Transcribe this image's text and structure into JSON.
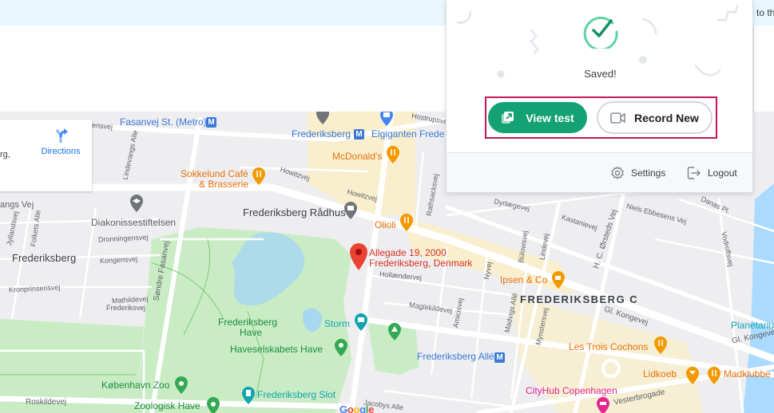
{
  "banner": {
    "text": "to th"
  },
  "popup": {
    "status": "Saved!",
    "view_test_label": "View test",
    "record_new_label": "Record New",
    "settings_label": "Settings",
    "logout_label": "Logout",
    "accent_color": "#14a274",
    "highlight_color": "#c2185b"
  },
  "map": {
    "info_card": {
      "partial_text": "rg,",
      "directions_label": "Directions"
    },
    "selected_pin": {
      "line1": "Allegade 19, 2000",
      "line2": "Frederiksberg, Denmark"
    },
    "labels": {
      "fasanvej_metro": "Fasanvej St. (Metro)",
      "frederiksberg_metro": "Frederiksberg",
      "elgiganten": "Elgiganten Frede",
      "mcdonalds": "McDonald's",
      "sokkelund1": "Sokkelund Café",
      "sokkelund2": "& Brasserie",
      "radhus": "Frederiksberg Rådhus",
      "olioli": "Olioli",
      "diakonisse": "Diakonissestiftelsen",
      "frederiksberg": "Frederiksberg",
      "frb_have1": "Frederiksberg",
      "frb_have2": "Have",
      "haveselskabets": "Haveselskabets Have",
      "storm": "Storm",
      "frb_alle": "Frederiksberg Allé",
      "frb_slot": "Frederiksberg Slot",
      "kbh_zoo": "København Zoo",
      "zoologisk": "Zoologisk Have",
      "ipsen": "Ipsen & Co",
      "frb_c": "FREDERIKSBERG C",
      "trois": "Les Trois Cochons",
      "lidkoeb": "Lidkoeb",
      "madklubben": "Madklubbe",
      "cityhub": "CityHub Copenhagen",
      "planetarium": "Planetariu",
      "metro_m": "M"
    },
    "streets": {
      "ensvej": "ensvej",
      "lindevangs": "Lindevangs Alle",
      "hostrups": "Hostrupsvej",
      "howitz1": "Howitzvej",
      "howitz2": "Howitzvej",
      "rathsacks": "Rathsacksvej",
      "angs_vej": "angs Vej",
      "jyllands": "Jyllandsvej",
      "folkets": "Folkets Alle",
      "dronningens": "Dronningensvej",
      "kongens": "Kongensvej",
      "sondre_fasanvej": "Søndre Fasanvej",
      "kronprinsens": "Kronprinsensvej",
      "mathilde": "Mathildevej",
      "frederiksvej": "Frederiksvej",
      "roskilde": "Roskildevej",
      "hollaender": "Hollændervej",
      "maglekilde": "Maglekildevej",
      "amicis": "Amicisvej",
      "madvigs": "Madvigs Allé",
      "jacobys": "Jacobys Alle",
      "dyrlaege": "Dyrlægevej",
      "kastanie": "Kastanievej",
      "hc_orsteds": "H. C. Ørsteds Vej",
      "niels_ebbesens": "Niels Ebbesens Vej",
      "danas": "Danas Pl.",
      "vodroffs": "Vodroffsvej",
      "bulows": "Bülowsvej",
      "lindevej": "Lindevej",
      "nyvej": "Nyvej",
      "mynsters": "Mynstersvej",
      "gl_kongevej1": "Gl. Kongevej",
      "gl_kongevej2": "Gl. Kongeve",
      "vesterbrogade": "Vesterbrogade"
    },
    "google_logo": "Google"
  }
}
